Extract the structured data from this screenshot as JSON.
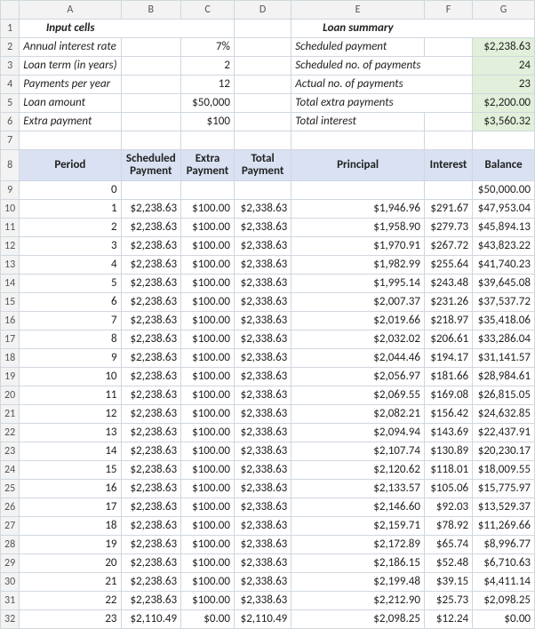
{
  "colHeaders": [
    "A",
    "B",
    "C",
    "D",
    "E",
    "F",
    "G"
  ],
  "rowNumbers": [
    "1",
    "2",
    "3",
    "4",
    "5",
    "6",
    "7",
    "8",
    "9",
    "10",
    "11",
    "12",
    "13",
    "14",
    "15",
    "16",
    "17",
    "18",
    "19",
    "20",
    "21",
    "22",
    "23",
    "24",
    "25",
    "26",
    "27",
    "28",
    "29",
    "30",
    "31",
    "32"
  ],
  "labels": {
    "inputCellsHeader": "Input cells",
    "loanSummaryHeader": "Loan summary",
    "annualInterestRate": "Annual interest rate",
    "loanTerm": "Loan term (in years)",
    "paymentsPerYear": "Payments per year",
    "loanAmount": "Loan amount",
    "extraPayment": "Extra payment",
    "scheduledPayment": "Scheduled payment",
    "scheduledNoPayments": "Scheduled no. of payments",
    "actualNoPayments": "Actual no. of payments",
    "totalExtraPayments": "Total extra payments",
    "totalInterest": "Total interest"
  },
  "inputs": {
    "annualInterestRate": "7%",
    "loanTerm": "2",
    "paymentsPerYear": "12",
    "loanAmount": "$50,000",
    "extraPayment": "$100"
  },
  "summary": {
    "scheduledPayment": "$2,238.63",
    "scheduledNoPayments": "24",
    "actualNoPayments": "23",
    "totalExtraPayments": "$2,200.00",
    "totalInterest": "$3,560.32"
  },
  "tableHeaders": {
    "period": "Period",
    "scheduledPayment": "Scheduled Payment",
    "extraPayment": "Extra Payment",
    "totalPayment": "Total Payment",
    "principal": "Principal",
    "interest": "Interest",
    "balance": "Balance"
  },
  "chart_data": {
    "type": "table",
    "columns": [
      "Period",
      "Scheduled Payment",
      "Extra Payment",
      "Total Payment",
      "Principal",
      "Interest",
      "Balance"
    ],
    "rows": [
      {
        "period": "0",
        "scheduled": "",
        "extra": "",
        "total": "",
        "principal": "",
        "interest": "",
        "balance": "$50,000.00"
      },
      {
        "period": "1",
        "scheduled": "$2,238.63",
        "extra": "$100.00",
        "total": "$2,338.63",
        "principal": "$1,946.96",
        "interest": "$291.67",
        "balance": "$47,953.04"
      },
      {
        "period": "2",
        "scheduled": "$2,238.63",
        "extra": "$100.00",
        "total": "$2,338.63",
        "principal": "$1,958.90",
        "interest": "$279.73",
        "balance": "$45,894.13"
      },
      {
        "period": "3",
        "scheduled": "$2,238.63",
        "extra": "$100.00",
        "total": "$2,338.63",
        "principal": "$1,970.91",
        "interest": "$267.72",
        "balance": "$43,823.22"
      },
      {
        "period": "4",
        "scheduled": "$2,238.63",
        "extra": "$100.00",
        "total": "$2,338.63",
        "principal": "$1,982.99",
        "interest": "$255.64",
        "balance": "$41,740.23"
      },
      {
        "period": "5",
        "scheduled": "$2,238.63",
        "extra": "$100.00",
        "total": "$2,338.63",
        "principal": "$1,995.14",
        "interest": "$243.48",
        "balance": "$39,645.08"
      },
      {
        "period": "6",
        "scheduled": "$2,238.63",
        "extra": "$100.00",
        "total": "$2,338.63",
        "principal": "$2,007.37",
        "interest": "$231.26",
        "balance": "$37,537.72"
      },
      {
        "period": "7",
        "scheduled": "$2,238.63",
        "extra": "$100.00",
        "total": "$2,338.63",
        "principal": "$2,019.66",
        "interest": "$218.97",
        "balance": "$35,418.06"
      },
      {
        "period": "8",
        "scheduled": "$2,238.63",
        "extra": "$100.00",
        "total": "$2,338.63",
        "principal": "$2,032.02",
        "interest": "$206.61",
        "balance": "$33,286.04"
      },
      {
        "period": "9",
        "scheduled": "$2,238.63",
        "extra": "$100.00",
        "total": "$2,338.63",
        "principal": "$2,044.46",
        "interest": "$194.17",
        "balance": "$31,141.57"
      },
      {
        "period": "10",
        "scheduled": "$2,238.63",
        "extra": "$100.00",
        "total": "$2,338.63",
        "principal": "$2,056.97",
        "interest": "$181.66",
        "balance": "$28,984.61"
      },
      {
        "period": "11",
        "scheduled": "$2,238.63",
        "extra": "$100.00",
        "total": "$2,338.63",
        "principal": "$2,069.55",
        "interest": "$169.08",
        "balance": "$26,815.05"
      },
      {
        "period": "12",
        "scheduled": "$2,238.63",
        "extra": "$100.00",
        "total": "$2,338.63",
        "principal": "$2,082.21",
        "interest": "$156.42",
        "balance": "$24,632.85"
      },
      {
        "period": "13",
        "scheduled": "$2,238.63",
        "extra": "$100.00",
        "total": "$2,338.63",
        "principal": "$2,094.94",
        "interest": "$143.69",
        "balance": "$22,437.91"
      },
      {
        "period": "14",
        "scheduled": "$2,238.63",
        "extra": "$100.00",
        "total": "$2,338.63",
        "principal": "$2,107.74",
        "interest": "$130.89",
        "balance": "$20,230.17"
      },
      {
        "period": "15",
        "scheduled": "$2,238.63",
        "extra": "$100.00",
        "total": "$2,338.63",
        "principal": "$2,120.62",
        "interest": "$118.01",
        "balance": "$18,009.55"
      },
      {
        "period": "16",
        "scheduled": "$2,238.63",
        "extra": "$100.00",
        "total": "$2,338.63",
        "principal": "$2,133.57",
        "interest": "$105.06",
        "balance": "$15,775.97"
      },
      {
        "period": "17",
        "scheduled": "$2,238.63",
        "extra": "$100.00",
        "total": "$2,338.63",
        "principal": "$2,146.60",
        "interest": "$92.03",
        "balance": "$13,529.37"
      },
      {
        "period": "18",
        "scheduled": "$2,238.63",
        "extra": "$100.00",
        "total": "$2,338.63",
        "principal": "$2,159.71",
        "interest": "$78.92",
        "balance": "$11,269.66"
      },
      {
        "period": "19",
        "scheduled": "$2,238.63",
        "extra": "$100.00",
        "total": "$2,338.63",
        "principal": "$2,172.89",
        "interest": "$65.74",
        "balance": "$8,996.77"
      },
      {
        "period": "20",
        "scheduled": "$2,238.63",
        "extra": "$100.00",
        "total": "$2,338.63",
        "principal": "$2,186.15",
        "interest": "$52.48",
        "balance": "$6,710.63"
      },
      {
        "period": "21",
        "scheduled": "$2,238.63",
        "extra": "$100.00",
        "total": "$2,338.63",
        "principal": "$2,199.48",
        "interest": "$39.15",
        "balance": "$4,411.14"
      },
      {
        "period": "22",
        "scheduled": "$2,238.63",
        "extra": "$100.00",
        "total": "$2,338.63",
        "principal": "$2,212.90",
        "interest": "$25.73",
        "balance": "$2,098.25"
      },
      {
        "period": "23",
        "scheduled": "$2,110.49",
        "extra": "$0.00",
        "total": "$2,110.49",
        "principal": "$2,098.25",
        "interest": "$12.24",
        "balance": "$0.00"
      }
    ]
  }
}
